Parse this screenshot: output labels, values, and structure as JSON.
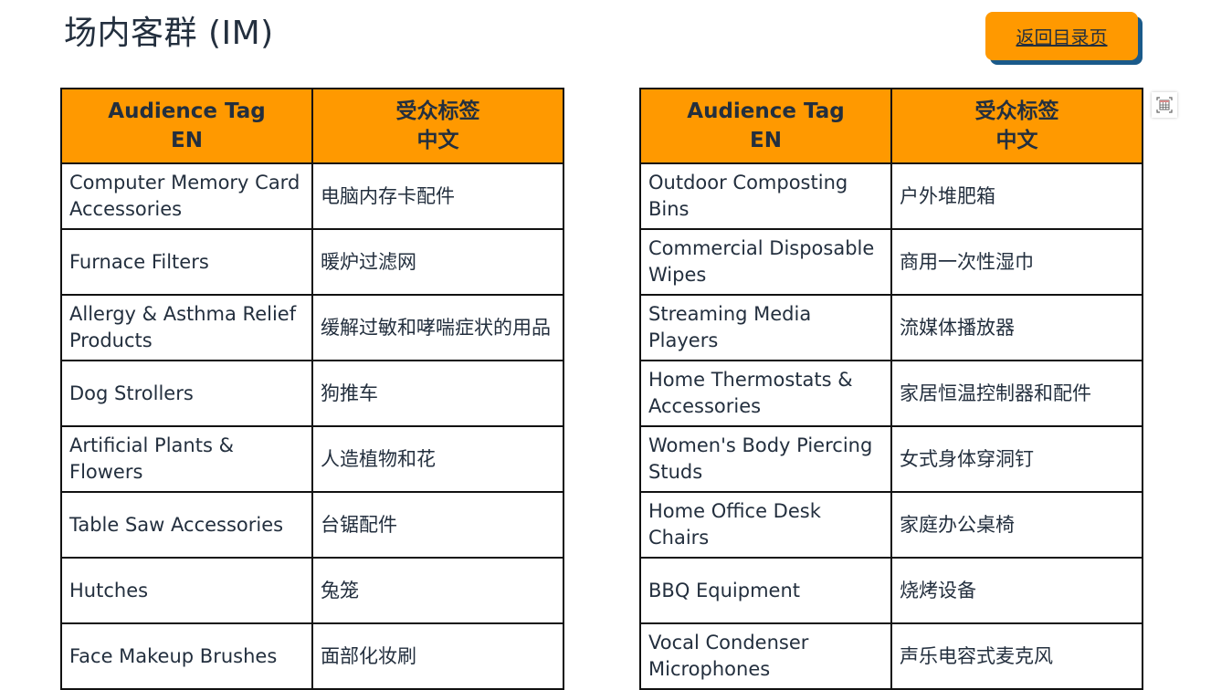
{
  "page": {
    "title": "场内客群 (IM)",
    "back_button_label": "返回目录页"
  },
  "colors": {
    "header_bg": "#ff9900",
    "button_bg": "#ff9900",
    "button_shadow": "#1a5a8a",
    "text": "#232f3e"
  },
  "tables": [
    {
      "headers": [
        {
          "line1": "Audience Tag",
          "line2": "EN"
        },
        {
          "line1": "受众标签",
          "line2": "中文"
        }
      ],
      "rows": [
        {
          "en": "Computer Memory Card Accessories",
          "zh": "电脑内存卡配件"
        },
        {
          "en": "Furnace Filters",
          "zh": "暖炉过滤网"
        },
        {
          "en": "Allergy & Asthma Relief Products",
          "zh": "缓解过敏和哮喘症状的用品"
        },
        {
          "en": "Dog Strollers",
          "zh": "狗推车"
        },
        {
          "en": "Artificial Plants & Flowers",
          "zh": "人造植物和花"
        },
        {
          "en": "Table Saw Accessories",
          "zh": "台锯配件"
        },
        {
          "en": "Hutches",
          "zh": "兔笼"
        },
        {
          "en": "Face Makeup Brushes",
          "zh": "面部化妆刷"
        }
      ]
    },
    {
      "headers": [
        {
          "line1": "Audience Tag",
          "line2": "EN"
        },
        {
          "line1": "受众标签",
          "line2": "中文"
        }
      ],
      "rows": [
        {
          "en": "Outdoor Composting Bins",
          "zh": "户外堆肥箱"
        },
        {
          "en": "Commercial Disposable Wipes",
          "zh": "商用一次性湿巾"
        },
        {
          "en": "Streaming Media Players",
          "zh": "流媒体播放器"
        },
        {
          "en": "Home Thermostats & Accessories",
          "zh": "家居恒温控制器和配件"
        },
        {
          "en": "Women's Body Piercing Studs",
          "zh": "女式身体穿洞钉"
        },
        {
          "en": "Home Office Desk Chairs",
          "zh": "家庭办公桌椅"
        },
        {
          "en": "BBQ Equipment",
          "zh": "烧烤设备"
        },
        {
          "en": "Vocal Condenser Microphones",
          "zh": "声乐电容式麦克风"
        }
      ]
    }
  ],
  "icons": {
    "table_select": "table-select-icon"
  }
}
